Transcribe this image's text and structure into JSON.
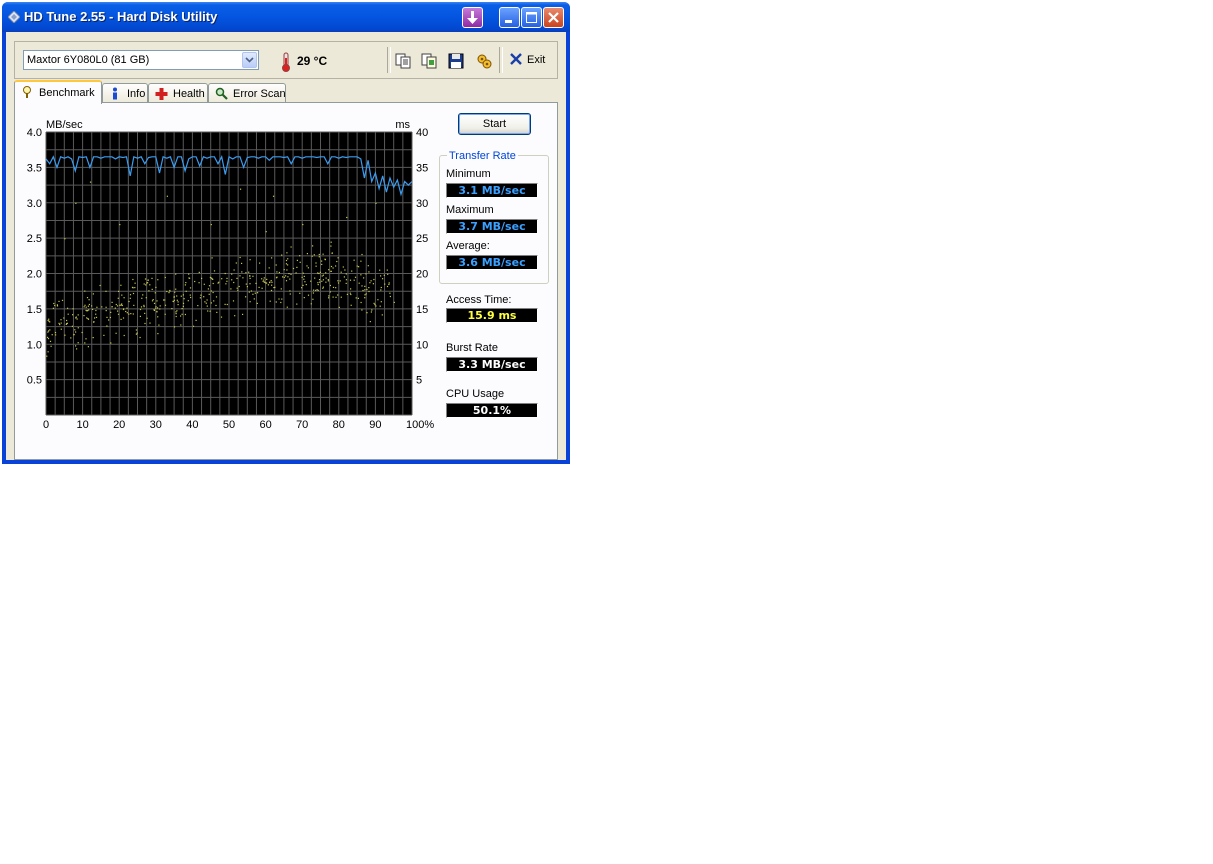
{
  "window": {
    "title": "HD Tune 2.55 - Hard Disk Utility"
  },
  "toolbar": {
    "drive": "Maxtor 6Y080L0 (81 GB)",
    "temperature": "29 °C",
    "exit_label": "Exit",
    "icons": [
      "copy-text-icon",
      "copy-image-icon",
      "save-icon",
      "options-icon"
    ]
  },
  "tabs": [
    {
      "label": "Benchmark",
      "active": true,
      "icon": "benchmark-icon"
    },
    {
      "label": "Info",
      "active": false,
      "icon": "info-icon"
    },
    {
      "label": "Health",
      "active": false,
      "icon": "health-icon"
    },
    {
      "label": "Error Scan",
      "active": false,
      "icon": "magnifier-icon"
    }
  ],
  "benchmark": {
    "start_label": "Start",
    "transfer_rate_title": "Transfer Rate",
    "minimum_label": "Minimum",
    "minimum_value": "3.1 MB/sec",
    "maximum_label": "Maximum",
    "maximum_value": "3.7 MB/sec",
    "average_label": "Average:",
    "average_value": "3.6 MB/sec",
    "access_label": "Access Time:",
    "access_value": "15.9 ms",
    "burst_label": "Burst Rate",
    "burst_value": "3.3 MB/sec",
    "cpu_label": "CPU Usage",
    "cpu_value": "50.1%"
  },
  "colors": {
    "transfer_line": "#3b9cf0",
    "access_points": "#c8c850",
    "access_value_text": "#ffff40",
    "rate_value_text": "#3ba0ff",
    "plain_value_text": "#ffffff"
  },
  "chart_data": {
    "type": "line",
    "background": "black",
    "grid": true,
    "y_left_label": "MB/sec",
    "y_right_label": "ms",
    "y_left_ticks": [
      "4.0",
      "3.5",
      "3.0",
      "2.5",
      "2.0",
      "1.5",
      "1.0",
      "0.5"
    ],
    "y_right_ticks": [
      "40",
      "35",
      "30",
      "25",
      "20",
      "15",
      "10",
      "5"
    ],
    "x_ticks": [
      "0",
      "10",
      "20",
      "30",
      "40",
      "50",
      "60",
      "70",
      "80",
      "90",
      "100%"
    ],
    "ylim": [
      0,
      4.0
    ],
    "y2lim": [
      0,
      40
    ],
    "xlim": [
      0,
      100
    ],
    "series": [
      {
        "axis": "left",
        "x": [
          0,
          1,
          2,
          3,
          4,
          5,
          6,
          7,
          8,
          9,
          10,
          11,
          12,
          13,
          14,
          15,
          16,
          17,
          18,
          19,
          20,
          21,
          22,
          23,
          24,
          25,
          26,
          27,
          28,
          29,
          30,
          31,
          32,
          33,
          34,
          35,
          36,
          37,
          38,
          39,
          40,
          41,
          42,
          43,
          44,
          45,
          46,
          47,
          48,
          49,
          50,
          51,
          52,
          53,
          54,
          55,
          56,
          57,
          58,
          59,
          60,
          61,
          62,
          63,
          64,
          65,
          66,
          67,
          68,
          69,
          70,
          71,
          72,
          73,
          74,
          75,
          76,
          77,
          78,
          79,
          80,
          81,
          82,
          83,
          84,
          85,
          86,
          87,
          88,
          89,
          90,
          91,
          92,
          93,
          94,
          95,
          96,
          97,
          98,
          99,
          100
        ],
        "values": [
          3.62,
          3.55,
          3.65,
          3.5,
          3.65,
          3.63,
          3.65,
          3.62,
          3.45,
          3.65,
          3.64,
          3.65,
          3.5,
          3.65,
          3.65,
          3.63,
          3.65,
          3.65,
          3.65,
          3.62,
          3.65,
          3.64,
          3.65,
          3.38,
          3.65,
          3.63,
          3.65,
          3.55,
          3.64,
          3.65,
          3.65,
          3.42,
          3.65,
          3.63,
          3.65,
          3.5,
          3.65,
          3.65,
          3.45,
          3.62,
          3.65,
          3.65,
          3.52,
          3.65,
          3.63,
          3.65,
          3.65,
          3.55,
          3.65,
          3.4,
          3.65,
          3.62,
          3.65,
          3.65,
          3.5,
          3.64,
          3.65,
          3.65,
          3.63,
          3.65,
          3.65,
          3.6,
          3.65,
          3.65,
          3.65,
          3.64,
          3.65,
          3.55,
          3.65,
          3.65,
          3.63,
          3.65,
          3.65,
          3.65,
          3.64,
          3.65,
          3.65,
          3.55,
          3.65,
          3.65,
          3.63,
          3.65,
          3.64,
          3.65,
          3.65,
          3.65,
          3.62,
          3.35,
          3.6,
          3.3,
          3.42,
          3.2,
          3.38,
          3.15,
          3.35,
          3.22,
          3.32,
          3.12,
          3.3,
          3.25,
          3.3
        ]
      },
      {
        "axis": "right",
        "kind": "scatter",
        "name": "access_time",
        "band_by_x": [
          [
            0,
            8,
            18
          ],
          [
            10,
            9,
            19
          ],
          [
            20,
            10,
            20
          ],
          [
            30,
            11,
            21
          ],
          [
            40,
            12,
            22
          ],
          [
            50,
            13,
            23
          ],
          [
            60,
            14,
            24
          ],
          [
            70,
            15,
            25
          ],
          [
            80,
            15,
            25
          ],
          [
            90,
            12,
            22
          ]
        ],
        "count": 520,
        "outliers": [
          [
            5,
            25
          ],
          [
            8,
            30
          ],
          [
            12,
            33
          ],
          [
            20,
            27
          ],
          [
            33,
            31
          ],
          [
            45,
            27
          ],
          [
            53,
            32
          ],
          [
            60,
            26
          ],
          [
            62,
            31
          ],
          [
            70,
            27
          ],
          [
            82,
            28
          ],
          [
            90,
            30
          ],
          [
            95,
            16
          ]
        ]
      }
    ]
  }
}
